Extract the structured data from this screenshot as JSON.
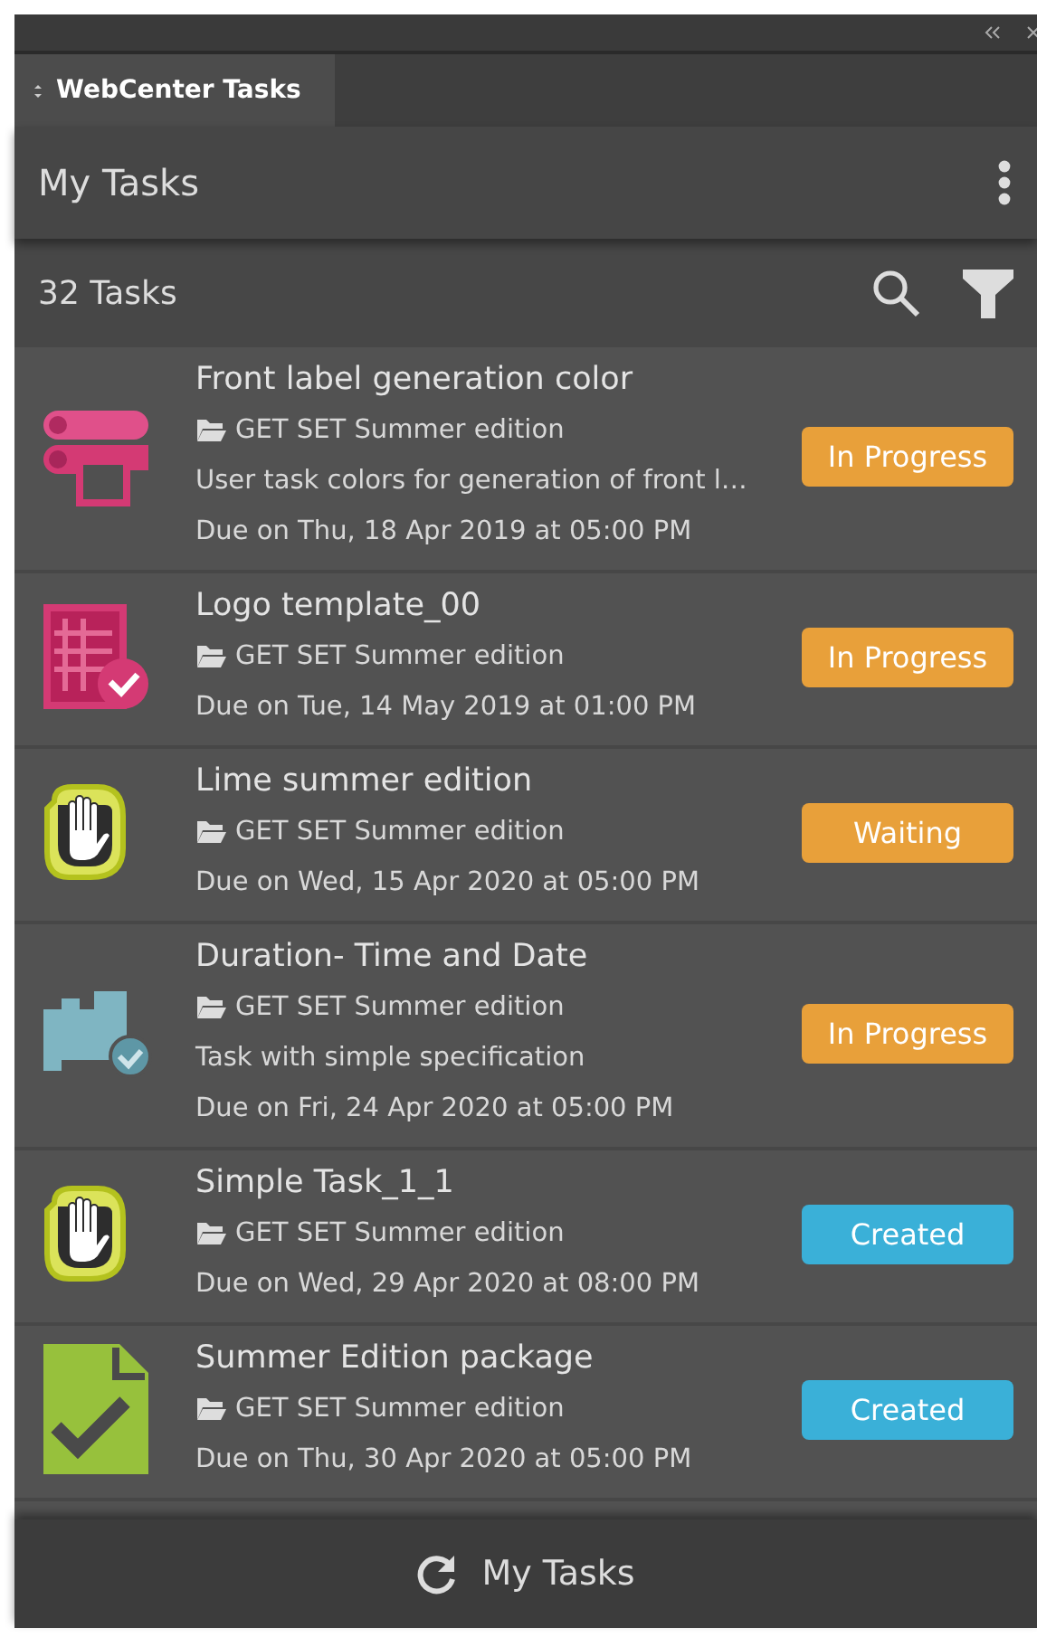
{
  "panel_tab": {
    "label": "WebCenter Tasks",
    "selected": true
  },
  "header": {
    "title": "My Tasks"
  },
  "toolbar": {
    "count": "32 Tasks"
  },
  "tasks": [
    {
      "kind": "roller",
      "title": "Front label generation color",
      "project": "GET SET Summer edition",
      "description": "User task colors for generation of front l…",
      "due": "Due on Thu, 18 Apr 2019 at 05:00 PM",
      "status": "In Progress",
      "color": "#e8a03a"
    },
    {
      "kind": "sheet",
      "title": "Logo template_00",
      "project": "GET SET Summer edition",
      "due": "Due on Tue, 14 May 2019 at 01:00 PM",
      "status": "In Progress",
      "color": "#e8a03a"
    },
    {
      "kind": "hand",
      "title": "Lime summer edition",
      "project": "GET SET Summer edition",
      "due": "Due on Wed, 15 Apr 2020 at 05:00 PM",
      "status": "Waiting",
      "color": "#e8a03a"
    },
    {
      "kind": "puzzle",
      "title": "Duration- Time and Date",
      "project": "GET SET Summer edition",
      "description": "Task with simple specification",
      "due": "Due on Fri, 24 Apr 2020 at 05:00 PM",
      "status": "In Progress",
      "color": "#e8a03a"
    },
    {
      "kind": "hand",
      "title": "Simple Task_1_1",
      "project": "GET SET Summer edition",
      "due": "Due on Wed, 29 Apr 2020 at 08:00 PM",
      "status": "Created",
      "color": "#3ab0d8"
    },
    {
      "kind": "document",
      "title": "Summer Edition package",
      "project": "GET SET Summer edition",
      "due": "Due on Thu, 30 Apr 2020 at 05:00 PM",
      "status": "Created",
      "color": "#3ab0d8"
    }
  ],
  "footer": {
    "label": "My Tasks"
  }
}
